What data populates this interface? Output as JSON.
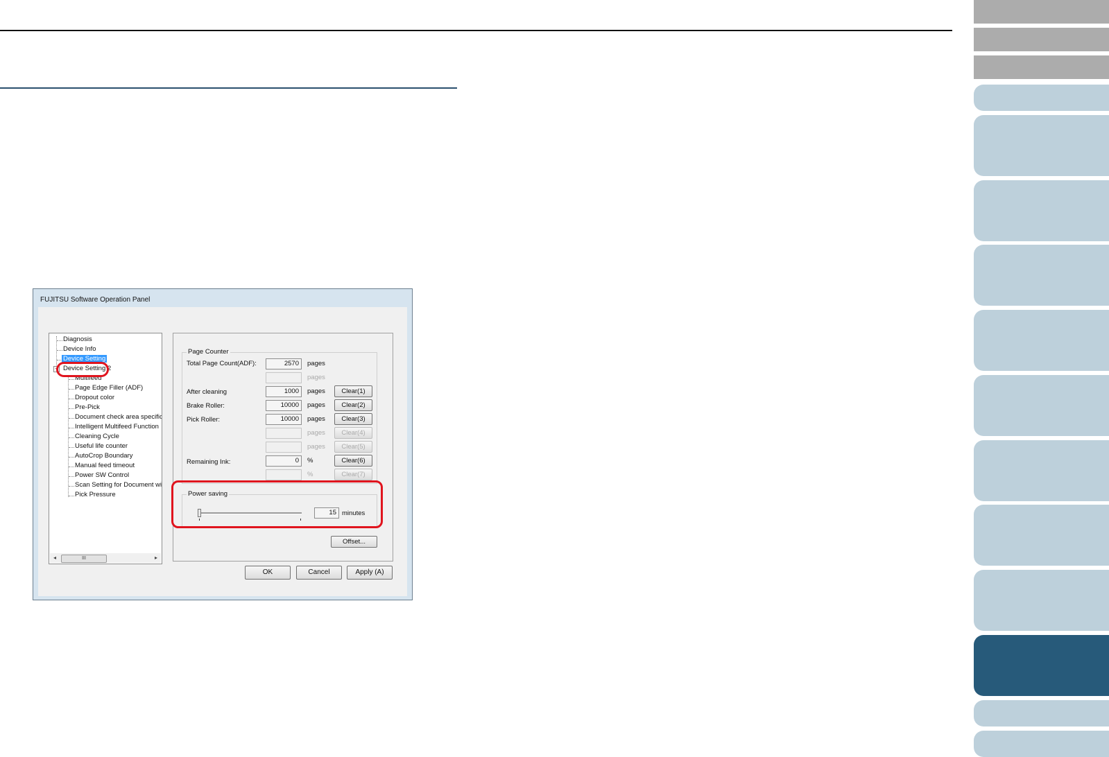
{
  "dialog": {
    "title": "FUJITSU Software Operation Panel",
    "tree": {
      "items": [
        {
          "label": "Diagnosis"
        },
        {
          "label": "Device Info"
        },
        {
          "label": "Device Setting"
        },
        {
          "label": "Device Setting 2"
        },
        {
          "label": "Multifeed"
        },
        {
          "label": "Page Edge Filler (ADF)"
        },
        {
          "label": "Dropout color"
        },
        {
          "label": "Pre-Pick"
        },
        {
          "label": "Document check area specific"
        },
        {
          "label": "Intelligent Multifeed Function"
        },
        {
          "label": "Cleaning Cycle"
        },
        {
          "label": "Useful life counter"
        },
        {
          "label": "AutoCrop Boundary"
        },
        {
          "label": "Manual feed timeout"
        },
        {
          "label": "Power SW Control"
        },
        {
          "label": "Scan Setting for Document wit"
        },
        {
          "label": "Pick Pressure"
        }
      ],
      "expander": "−",
      "scroll_left": "◂",
      "scroll_right": "▸",
      "scroll_grip": "III"
    },
    "page_counter": {
      "label": "Page Counter",
      "rows": [
        {
          "label": "Total Page Count(ADF):",
          "value": "2570",
          "unit": "pages",
          "button": ""
        },
        {
          "label": "",
          "value": "",
          "unit": "pages",
          "button": ""
        },
        {
          "label": "After cleaning",
          "value": "1000",
          "unit": "pages",
          "button": "Clear(1)"
        },
        {
          "label": "Brake Roller:",
          "value": "10000",
          "unit": "pages",
          "button": "Clear(2)"
        },
        {
          "label": "Pick Roller:",
          "value": "10000",
          "unit": "pages",
          "button": "Clear(3)"
        },
        {
          "label": "",
          "value": "",
          "unit": "pages",
          "button": "Clear(4)"
        },
        {
          "label": "",
          "value": "",
          "unit": "pages",
          "button": "Clear(5)"
        },
        {
          "label": "Remaining Ink:",
          "value": "0",
          "unit": "%",
          "button": "Clear(6)"
        },
        {
          "label": "",
          "value": "",
          "unit": "%",
          "button": "Clear(7)"
        }
      ]
    },
    "power_saving": {
      "label": "Power saving",
      "value": "15",
      "unit": "minutes"
    },
    "offset_button": "Offset...",
    "ok_button": "OK",
    "cancel_button": "Cancel",
    "apply_button": "Apply (A)"
  },
  "colors": {
    "accent_tab": "#275a7a",
    "light_tab": "#bdd0db",
    "gray_tab": "#acacac",
    "highlight": "#e0141e",
    "selection": "#3399ff"
  }
}
